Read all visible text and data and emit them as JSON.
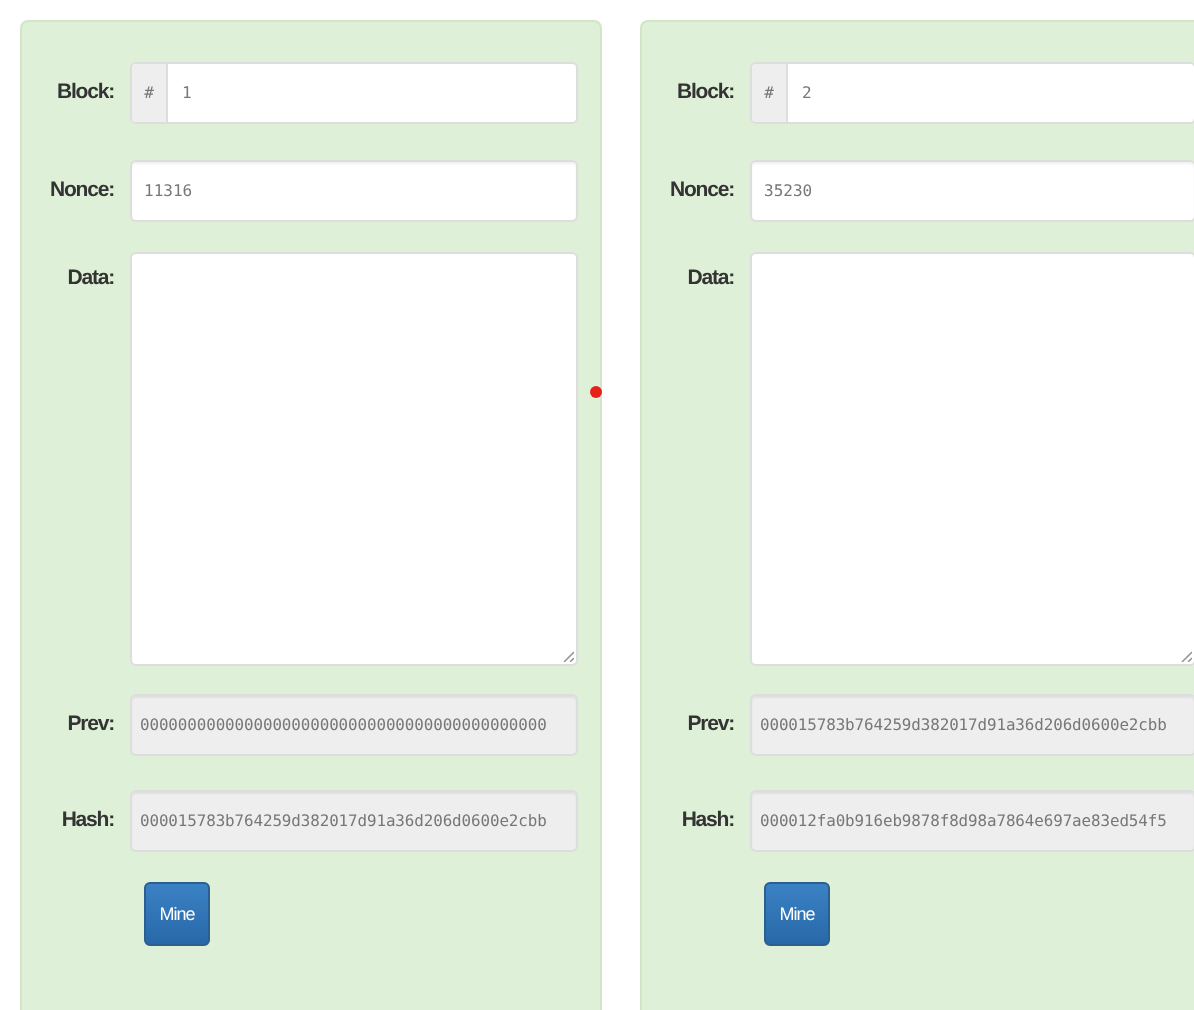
{
  "blocks": [
    {
      "block_label": "Block:",
      "block_prefix": "#",
      "block": "1",
      "nonce_label": "Nonce:",
      "nonce": "11316",
      "data_label": "Data:",
      "prev_label": "Prev:",
      "prev": "0000000000000000000000000000000000000000000",
      "hash_label": "Hash:",
      "hash": "000015783b764259d382017d91a36d206d0600e2cbb",
      "button": "Mine"
    },
    {
      "block_label": "Block:",
      "block_prefix": "#",
      "block": "2",
      "nonce_label": "Nonce:",
      "nonce": "35230",
      "data_label": "Data:",
      "prev_label": "Prev:",
      "prev": "000015783b764259d382017d91a36d206d0600e2cbb",
      "hash_label": "Hash:",
      "hash": "000012fa0b916eb9878f8d98a7864e697ae83ed54f5",
      "button": "Mine"
    }
  ]
}
